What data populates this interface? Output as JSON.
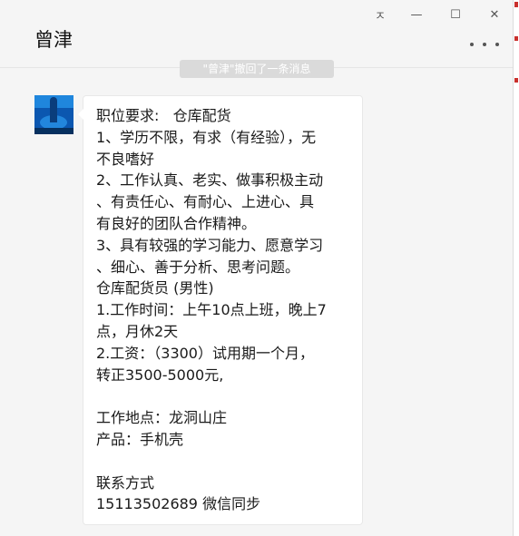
{
  "window": {
    "title": "曾津",
    "controls": {
      "pin": "ㅈ",
      "minimize": "—",
      "maximize": "☐",
      "close": "✕"
    }
  },
  "chat": {
    "recall_notice": "\"曾津\"撤回了一条消息",
    "message_lines": [
      "职位要求:   仓库配货",
      "1、学历不限，有求（有经验），无",
      "不良嗜好",
      "2、工作认真、老实、做事积极主动",
      "、有责任心、有耐心、上进心、具",
      "有良好的团队合作精神。",
      "3、具有较强的学习能力、愿意学习",
      "、细心、善于分析、思考问题。",
      "仓库配货员 (男性)",
      "1.工作时间：上午10点上班，晚上7",
      "点，月休2天",
      "2.工资：（3300）试用期一个月，",
      "转正3500-5000元,",
      "",
      "工作地点：龙洞山庄",
      "产品：手机壳",
      "",
      "联系方式",
      "15113502689 微信同步"
    ]
  },
  "colors": {
    "background": "#f5f5f5",
    "bubble": "#ffffff",
    "text": "#1a1a1a",
    "edge_accent": "#c9302c"
  }
}
